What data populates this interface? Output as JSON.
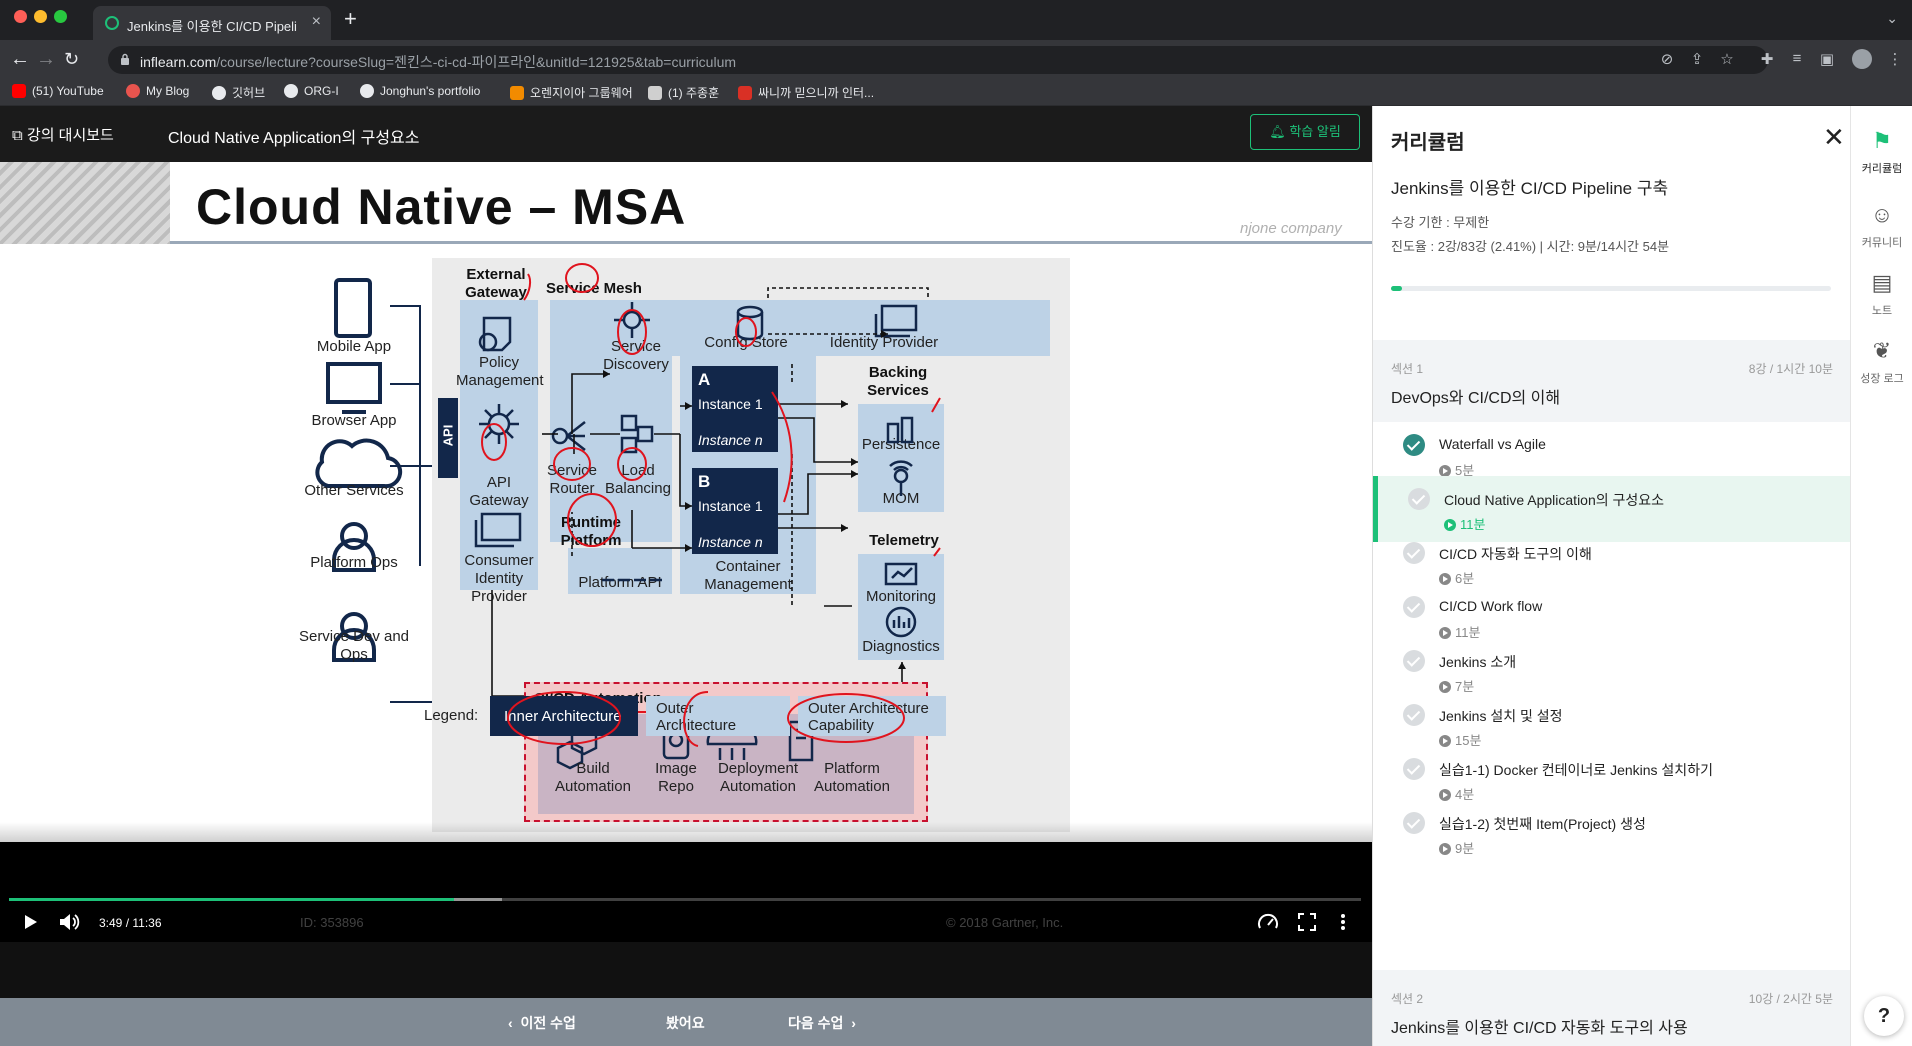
{
  "browser": {
    "tab_title": "Jenkins를 이용한 CI/CD Pipeline",
    "url_domain": "inflearn.com",
    "url_path": "/course/lecture?courseSlug=젠킨스-ci-cd-파이프라인&unitId=121925&tab=curriculum",
    "bookmarks": [
      {
        "label": "(51) YouTube",
        "color": "#ff0000"
      },
      {
        "label": "My Blog",
        "color": "#e8544e"
      },
      {
        "label": "깃허브",
        "color": "#e8eaed"
      },
      {
        "label": "ORG-I",
        "color": "#e8eaed"
      },
      {
        "label": "Jonghun's portfolio",
        "color": "#e8eaed"
      },
      {
        "label": "오렌지이아 그룹웨어",
        "color": "#f28b00"
      },
      {
        "label": "(1) 주종훈",
        "color": "#cfcfcf"
      },
      {
        "label": "싸니까 믿으니까 인터...",
        "color": "#d93025"
      }
    ]
  },
  "player": {
    "dashboard_label": "강의 대시보드",
    "lecture_title": "Cloud Native Application의 구성요소",
    "alert_button": "학습 알림",
    "time": "3:49 / 11:36",
    "progress_fraction": 0.329,
    "buffer_fraction": 0.365,
    "watermark_id": "ID: 353896",
    "watermark_copyright": "© 2018 Gartner, Inc."
  },
  "slide": {
    "title": "Cloud Native – MSA",
    "brand": "njone company",
    "clients": [
      "Mobile App",
      "Browser App",
      "Other Services",
      "Platform Ops",
      "Service Dev and Ops"
    ],
    "api_label": "API",
    "external_gateway": "External Gateway",
    "policy_management": "Policy Management",
    "api_gateway": "API Gateway",
    "consumer_identity": "Consumer Identity Provider",
    "service_mesh": "Service Mesh",
    "service_discovery": "Service Discovery",
    "config_store": "Config Store",
    "identity_provider": "Identity Provider",
    "service_router": "Service Router",
    "load_balancing": "Load Balancing",
    "runtime_platform": "Runtime Platform",
    "platform_api": "Platform API",
    "instance_a": "A",
    "instance_b": "B",
    "instance_1": "Instance 1",
    "instance_n": "Instance n",
    "container_management": "Container Management",
    "backing_services": "Backing Services",
    "persistence": "Persistence",
    "mom": "MOM",
    "telemetry": "Telemetry",
    "monitoring": "Monitoring",
    "diagnostics": "Diagnostics",
    "cicd_automation": "CI/CD Automation",
    "cicd_items": [
      "Build Automation",
      "Image Repo",
      "Deployment Automation",
      "Platform Automation"
    ],
    "legend_label": "Legend:",
    "legend_items": [
      "Inner Architecture",
      "Outer Architecture",
      "Outer Architecture Capability"
    ]
  },
  "bottom_nav": {
    "prev": "이전 수업",
    "done": "봤어요",
    "next": "다음 수업"
  },
  "curriculum": {
    "panel_title": "커리큘럼",
    "course_title": "Jenkins를 이용한 CI/CD Pipeline 구축",
    "period": "수강 기한 : 무제한",
    "progress_text": "진도율 : 2강/83강 (2.41%) | 시간: 9분/14시간 54분",
    "progress_fraction": 0.0241,
    "sections": [
      {
        "num": "섹션 1",
        "meta": "8강 / 1시간 10분",
        "name": "DevOps와 CI/CD의 이해"
      },
      {
        "num": "섹션 2",
        "meta": "10강 / 2시간 5분",
        "name": "Jenkins를 이용한 CI/CD 자동화 도구의 사용"
      }
    ],
    "lessons": [
      {
        "title": "Waterfall vs Agile",
        "duration": "5분",
        "done": true,
        "active": false
      },
      {
        "title": "Cloud Native Application의 구성요소",
        "duration": "11분",
        "done": false,
        "active": true
      },
      {
        "title": "CI/CD 자동화 도구의 이해",
        "duration": "6분",
        "done": false,
        "active": false
      },
      {
        "title": "CI/CD Work flow",
        "duration": "11분",
        "done": false,
        "active": false
      },
      {
        "title": "Jenkins 소개",
        "duration": "7분",
        "done": false,
        "active": false
      },
      {
        "title": "Jenkins 설치 및 설정",
        "duration": "15분",
        "done": false,
        "active": false
      },
      {
        "title": "실습1-1) Docker 컨테이너로 Jenkins 설치하기",
        "duration": "4분",
        "done": false,
        "active": false
      },
      {
        "title": "실습1-2) 첫번째 Item(Project) 생성",
        "duration": "9분",
        "done": false,
        "active": false
      }
    ]
  },
  "rail": {
    "items": [
      "커리큘럼",
      "커뮤니티",
      "노트",
      "성장 로그"
    ],
    "help": "?"
  },
  "colors": {
    "accent": "#1dc078",
    "check_done": "#2e8b83",
    "inner_architecture": "#12274a",
    "outer_architecture": "#bdd2e6"
  }
}
